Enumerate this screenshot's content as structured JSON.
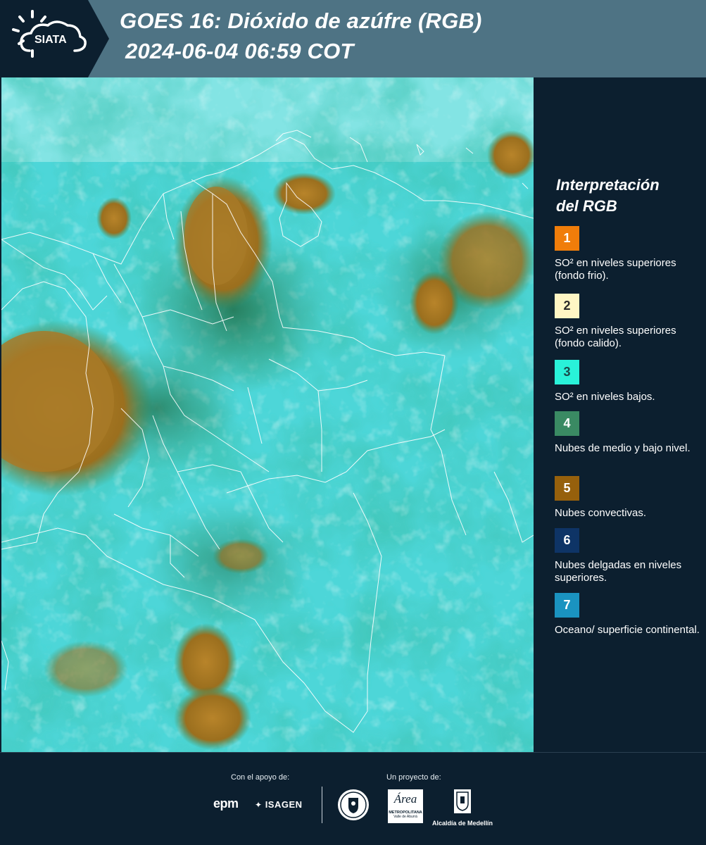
{
  "header": {
    "logo_text": "SIATA",
    "title_line1": "GOES 16: Dióxido de azúfre (RGB)",
    "title_line2": "2024-06-04 06:59 COT"
  },
  "map": {
    "description_icon": "satellite-map-image"
  },
  "legend": {
    "title_line1": "Interpretación",
    "title_line2": "del RGB",
    "items": [
      {
        "number": "1",
        "color": "#f07d0a",
        "text_color": "#ffffff",
        "text": "SO² en niveles superiores (fondo frio)."
      },
      {
        "number": "2",
        "color": "#fff6c4",
        "text_color": "#2a2a2a",
        "text": "SO² en niveles superiores (fondo calido)."
      },
      {
        "number": "3",
        "color": "#29f2d9",
        "text_color": "#1b4a4a",
        "text": "SO² en niveles bajos."
      },
      {
        "number": "4",
        "color": "#3a8a63",
        "text_color": "#ffffff",
        "text": "Nubes de medio y bajo nivel."
      },
      {
        "number": "5",
        "color": "#96600c",
        "text_color": "#ffffff",
        "text": "Nubes convectivas."
      },
      {
        "number": "6",
        "color": "#0e3466",
        "text_color": "#ffffff",
        "text": "Nubes delgadas en niveles superiores."
      },
      {
        "number": "7",
        "color": "#1a93c0",
        "text_color": "#ffffff",
        "text": "Oceano/ superficie continental."
      }
    ]
  },
  "footer": {
    "support_label": "Con el apoyo de:",
    "project_label": "Un proyecto de:",
    "partner_epm": "epm",
    "partner_isagen": "ISAGEN",
    "partner_area_line1": "Área",
    "partner_area_line2": "METROPOLITANA",
    "partner_area_line3": "Valle de Aburrá",
    "partner_alcaldia": "Alcaldía de Medellín"
  }
}
